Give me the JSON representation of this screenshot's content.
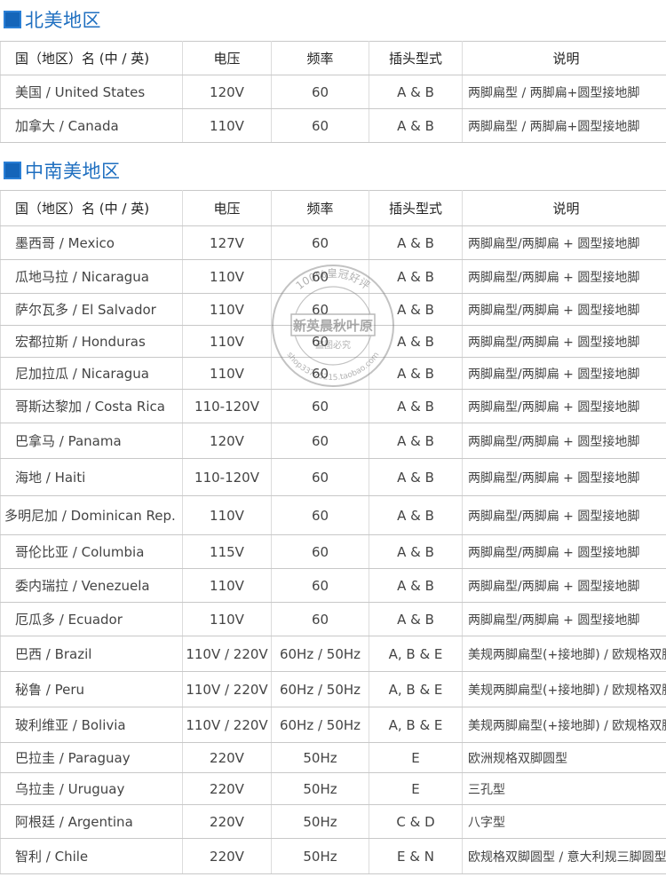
{
  "north_america": {
    "title": "北美地区",
    "header": [
      "国（地区）名 (中 / 英)",
      "电压",
      "频率",
      "插头型式",
      "说明"
    ],
    "rows": [
      [
        "美国 / United States",
        "120V",
        "60",
        "A & B",
        "两脚扁型 / 两脚扁+圆型接地脚"
      ],
      [
        "加拿大 / Canada",
        "110V",
        "60",
        "A & B",
        "两脚扁型 / 两脚扁+圆型接地脚"
      ]
    ]
  },
  "latin_america": {
    "title": "中南美地区",
    "header": [
      "国（地区）名 (中 / 英)",
      "电压",
      "频率",
      "插头型式",
      "说明"
    ],
    "rows": [
      [
        "墨西哥 / Mexico",
        "127V",
        "60",
        "A & B",
        "两脚扁型/两脚扁 + 圆型接地脚"
      ],
      [
        "瓜地马拉 / Nicaragua",
        "110V",
        "60",
        "A & B",
        "两脚扁型/两脚扁 + 圆型接地脚"
      ],
      [
        "萨尔瓦多 / El Salvador",
        "110V",
        "60",
        "A & B",
        "两脚扁型/两脚扁 + 圆型接地脚"
      ],
      [
        "宏都拉斯 / Honduras",
        "110V",
        "60",
        "A & B",
        "两脚扁型/两脚扁 + 圆型接地脚"
      ],
      [
        "尼加拉瓜 / Nicaragua",
        "110V",
        "60",
        "A & B",
        "两脚扁型/两脚扁 + 圆型接地脚"
      ],
      [
        "哥斯达黎加 / Costa Rica",
        "110-120V",
        "60",
        "A & B",
        "两脚扁型/两脚扁 + 圆型接地脚"
      ],
      [
        "巴拿马 / Panama",
        "120V",
        "60",
        "A & B",
        "两脚扁型/两脚扁 + 圆型接地脚"
      ],
      [
        "海地 / Haiti",
        "110-120V",
        "60",
        "A & B",
        "两脚扁型/两脚扁 + 圆型接地脚"
      ],
      [
        "多明尼加 / Dominican Rep.",
        "110V",
        "60",
        "A & B",
        "两脚扁型/两脚扁 + 圆型接地脚"
      ],
      [
        "哥伦比亚 / Columbia",
        "115V",
        "60",
        "A & B",
        "两脚扁型/两脚扁 + 圆型接地脚"
      ],
      [
        "委内瑞拉 / Venezuela",
        "110V",
        "60",
        "A & B",
        "两脚扁型/两脚扁 + 圆型接地脚"
      ],
      [
        "厄瓜多 / Ecuador",
        "110V",
        "60",
        "A & B",
        "两脚扁型/两脚扁 + 圆型接地脚"
      ],
      [
        "巴西 / Brazil",
        "110V / 220V",
        "60Hz / 50Hz",
        "A, B & E",
        "美规两脚扁型(+接地脚) / 欧规格双脚圆型"
      ],
      [
        "秘鲁 / Peru",
        "110V / 220V",
        "60Hz / 50Hz",
        "A, B & E",
        "美规两脚扁型(+接地脚) / 欧规格双脚圆型"
      ],
      [
        "玻利维亚 / Bolivia",
        "110V / 220V",
        "60Hz / 50Hz",
        "A, B & E",
        "美规两脚扁型(+接地脚) / 欧规格双脚圆型"
      ],
      [
        "巴拉圭 / Paraguay",
        "220V",
        "50Hz",
        "E",
        "欧洲规格双脚圆型"
      ],
      [
        "乌拉圭 / Uruguay",
        "220V",
        "50Hz",
        "E",
        "三孔型"
      ],
      [
        "阿根廷 / Argentina",
        "220V",
        "50Hz",
        "C & D",
        "八字型"
      ],
      [
        "智利 / Chile",
        "220V",
        "50Hz",
        "E & N",
        "欧规格双脚圆型 / 意大利规三脚圆型"
      ]
    ]
  },
  "watermark": {
    "ring_top": "100%皇冠好评",
    "center": "新英晨秋叶原",
    "sub": "盗图必究",
    "ring_bottom": "shop33775215.taobao.com"
  },
  "colors": {
    "title": "#1f6fc0",
    "marker": "#1565b9",
    "grid": "#c8c8c8"
  }
}
